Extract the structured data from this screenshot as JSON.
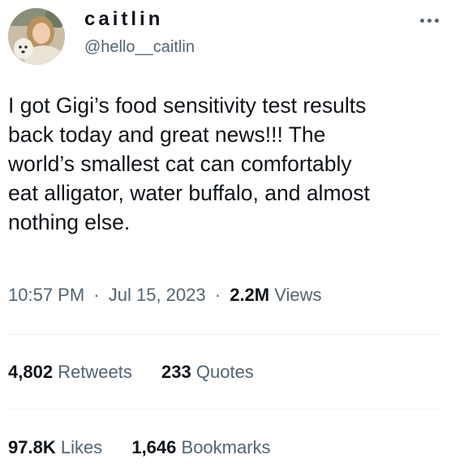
{
  "author": {
    "display_name": "caitlin",
    "handle": "@hello__caitlin",
    "avatar_icon": "profile-photo-with-dog",
    "more_icon": "ellipsis-icon"
  },
  "tweet": {
    "lines": [
      "I got Gigi’s food sensitivity test results",
      "back today and great news!!! The",
      "world’s smallest cat can comfortably",
      "eat alligator, water buffalo, and almost",
      "nothing else."
    ]
  },
  "meta": {
    "time": "10:57 PM",
    "date": "Jul 15, 2023",
    "separator": "·",
    "views_count": "2.2M",
    "views_label": "Views"
  },
  "stats": {
    "retweets_count": "4,802",
    "retweets_label": "Retweets",
    "quotes_count": "233",
    "quotes_label": "Quotes",
    "likes_count": "97.8K",
    "likes_label": "Likes",
    "bookmarks_count": "1,646",
    "bookmarks_label": "Bookmarks"
  },
  "colors": {
    "text_primary": "#0f1419",
    "text_secondary": "#536471",
    "divider": "#eff3f4"
  }
}
